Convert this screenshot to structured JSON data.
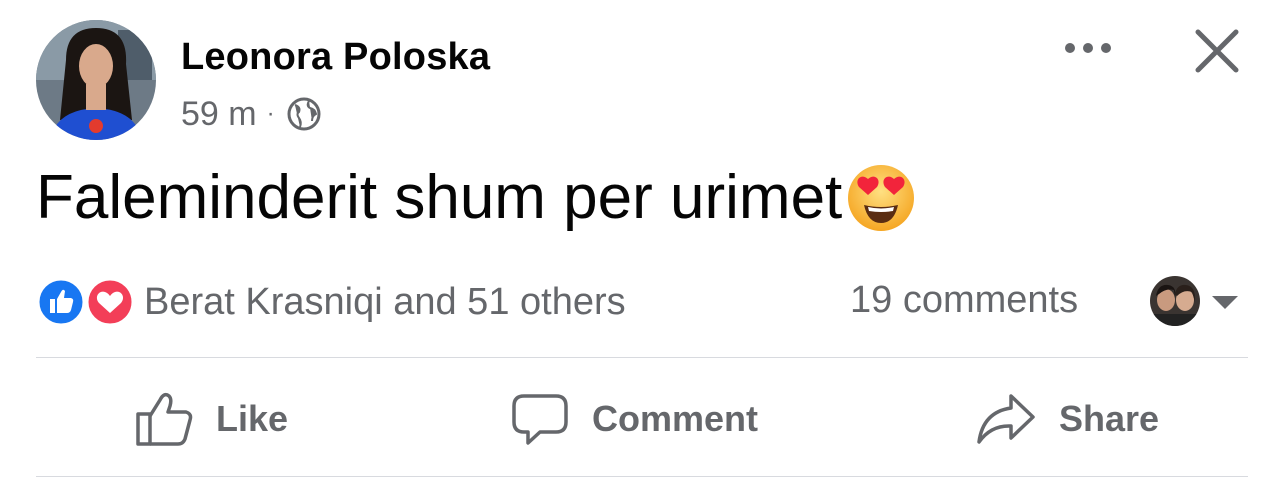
{
  "post": {
    "author": "Leonora Poloska",
    "time": "59 m",
    "separator": "·",
    "privacy_icon": "globe-icon",
    "text": "Faleminderit shum per urimet",
    "emoji": "smiling-face-with-heart-eyes"
  },
  "reactions": {
    "icons": [
      "like-reaction-icon",
      "love-reaction-icon"
    ],
    "summary": "Berat Krasniqi and 51 others",
    "comments": "19 comments"
  },
  "actions": {
    "like": "Like",
    "comment": "Comment",
    "share": "Share"
  },
  "colors": {
    "text_primary": "#050505",
    "text_secondary": "#65676b",
    "like_blue": "#1877f2",
    "love_red": "#f33e58",
    "divider": "#d8dadf"
  }
}
